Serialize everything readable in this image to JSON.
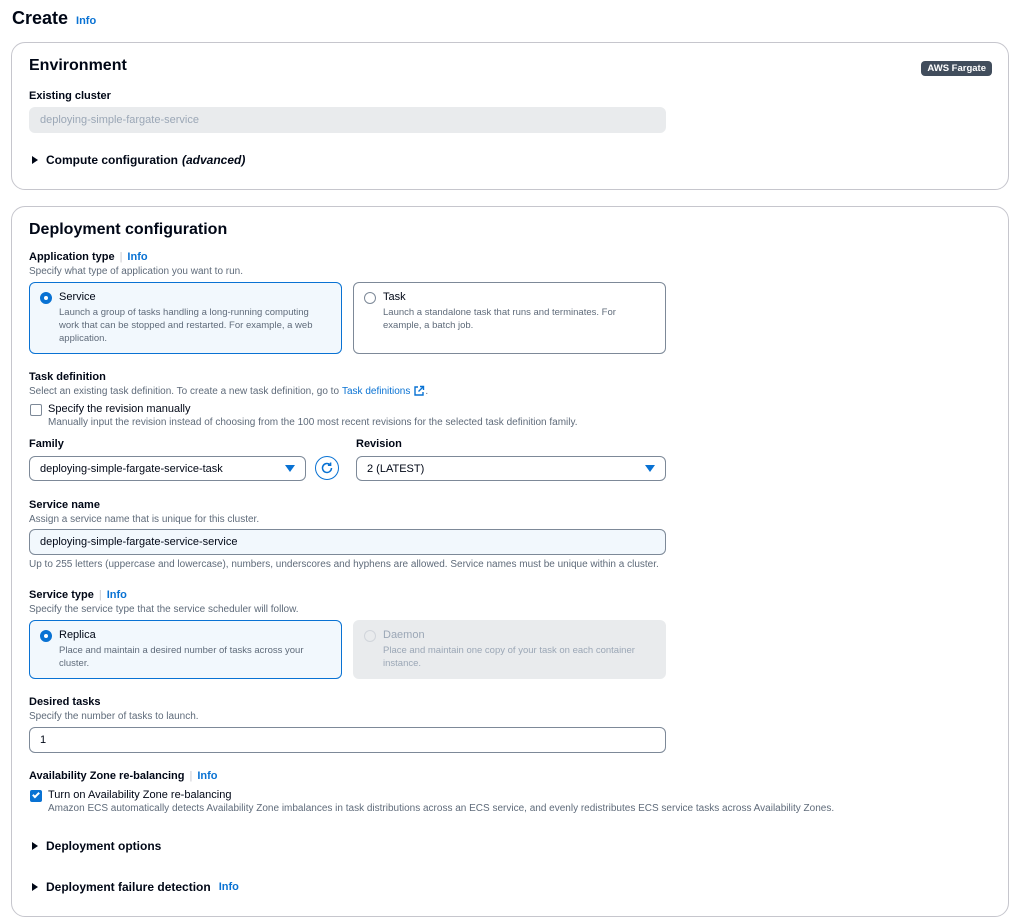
{
  "page": {
    "title": "Create",
    "info": "Info"
  },
  "environment": {
    "heading": "Environment",
    "badge": "AWS Fargate",
    "existing_cluster_label": "Existing cluster",
    "existing_cluster_value": "deploying-simple-fargate-service",
    "compute_config_label": "Compute configuration",
    "compute_config_suffix": "(advanced)"
  },
  "deployment": {
    "heading": "Deployment configuration",
    "app_type": {
      "label": "Application type",
      "info": "Info",
      "description": "Specify what type of application you want to run.",
      "options": [
        {
          "title": "Service",
          "description_lines": [
            "Launch a group of tasks handling a long-running computing",
            "work that can be stopped and restarted. For example, a web",
            "application."
          ],
          "selected": true
        },
        {
          "title": "Task",
          "description_lines": [
            "Launch a standalone task that runs and terminates. For",
            "example, a batch job."
          ],
          "selected": false
        }
      ]
    },
    "task_def": {
      "label": "Task definition",
      "description": "Select an existing task definition. To create a new task definition, go to",
      "link": "Task definitions",
      "description_end": ".",
      "manual_label": "Specify the revision manually",
      "manual_description": "Manually input the revision instead of choosing from the 100 most recent revisions for the selected task definition family.",
      "manual_checked": false,
      "family_label": "Family",
      "family_value": "deploying-simple-fargate-service-task",
      "revision_label": "Revision",
      "revision_value": "2 (LATEST)"
    },
    "service_name": {
      "label": "Service name",
      "description": "Assign a service name that is unique for this cluster.",
      "value": "deploying-simple-fargate-service-service",
      "constraint": "Up to 255 letters (uppercase and lowercase), numbers, underscores and hyphens are allowed. Service names must be unique within a cluster."
    },
    "service_type": {
      "label": "Service type",
      "info": "Info",
      "description": "Specify the service type that the service scheduler will follow.",
      "options": [
        {
          "title": "Replica",
          "description_lines": [
            "Place and maintain a desired number of tasks across your",
            "cluster."
          ],
          "selected": true,
          "disabled": false
        },
        {
          "title": "Daemon",
          "description_lines": [
            "Place and maintain one copy of your task on each container",
            "instance."
          ],
          "selected": false,
          "disabled": true
        }
      ]
    },
    "desired_tasks": {
      "label": "Desired tasks",
      "description": "Specify the number of tasks to launch.",
      "value": "1"
    },
    "az_rebalancing": {
      "label": "Availability Zone re-balancing",
      "info": "Info",
      "checkbox_label": "Turn on Availability Zone re-balancing",
      "checkbox_description": "Amazon ECS automatically detects Availability Zone imbalances in task distributions across an ECS service, and evenly redistributes ECS service tasks across Availability Zones.",
      "checked": true
    },
    "deployment_options": "Deployment options",
    "failure_detection": {
      "label": "Deployment failure detection",
      "info": "Info"
    }
  },
  "colors": {
    "accent": "#0972d3",
    "badge_bg": "#414d5c",
    "selected_tile_bg": "#f2f8fd"
  },
  "icons": {
    "refresh": "refresh-icon",
    "external_link": "external-link-icon"
  }
}
